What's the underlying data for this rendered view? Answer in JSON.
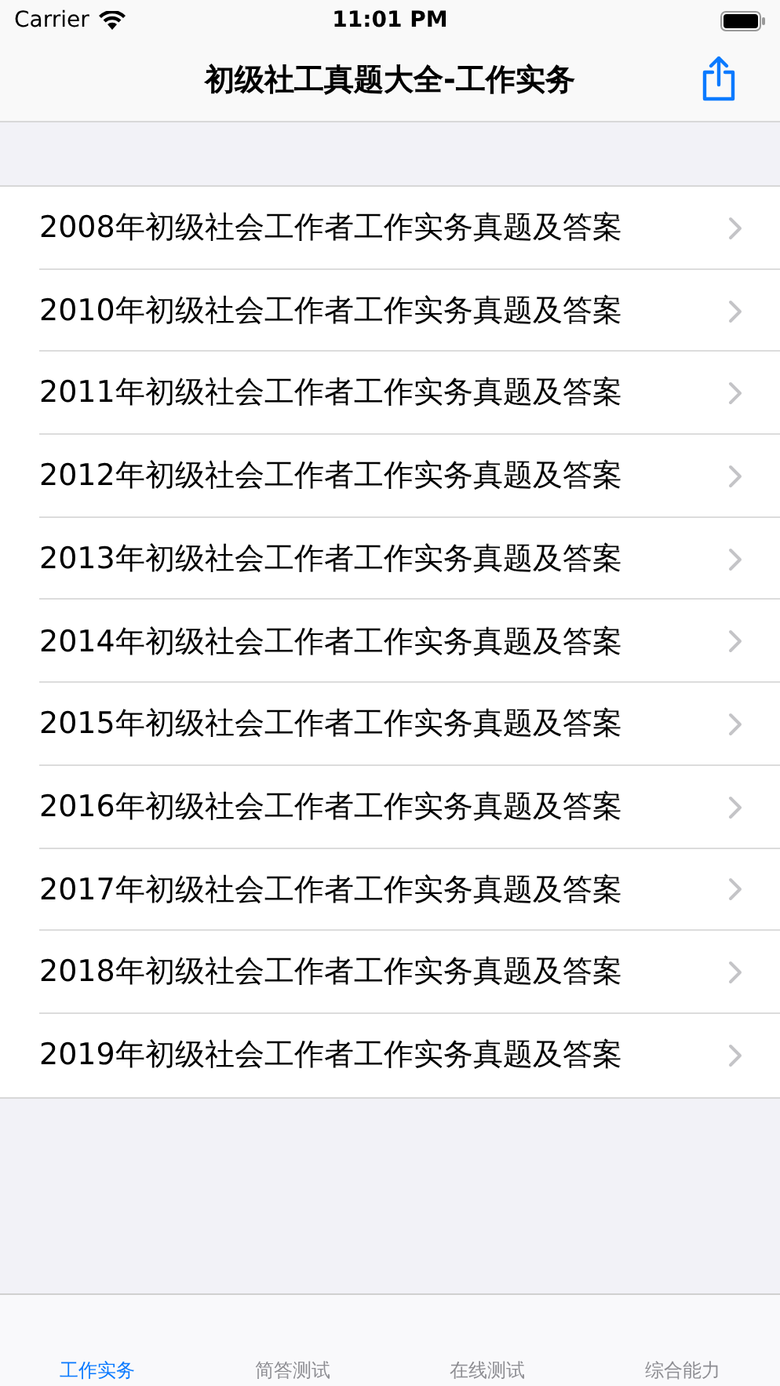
{
  "status_bar": {
    "carrier": "Carrier",
    "time": "11:01 PM"
  },
  "nav_bar": {
    "title": "初级社工真题大全-工作实务"
  },
  "list": [
    {
      "title": "2008年初级社会工作者工作实务真题及答案"
    },
    {
      "title": "2010年初级社会工作者工作实务真题及答案"
    },
    {
      "title": "2011年初级社会工作者工作实务真题及答案"
    },
    {
      "title": "2012年初级社会工作者工作实务真题及答案"
    },
    {
      "title": "2013年初级社会工作者工作实务真题及答案"
    },
    {
      "title": "2014年初级社会工作者工作实务真题及答案"
    },
    {
      "title": "2015年初级社会工作者工作实务真题及答案"
    },
    {
      "title": "2016年初级社会工作者工作实务真题及答案"
    },
    {
      "title": "2017年初级社会工作者工作实务真题及答案"
    },
    {
      "title": "2018年初级社会工作者工作实务真题及答案"
    },
    {
      "title": "2019年初级社会工作者工作实务真题及答案"
    }
  ],
  "tabs": [
    {
      "label": "工作实务",
      "selected": true
    },
    {
      "label": "简答测试",
      "selected": false
    },
    {
      "label": "在线测试",
      "selected": false
    },
    {
      "label": "综合能力",
      "selected": false
    }
  ]
}
